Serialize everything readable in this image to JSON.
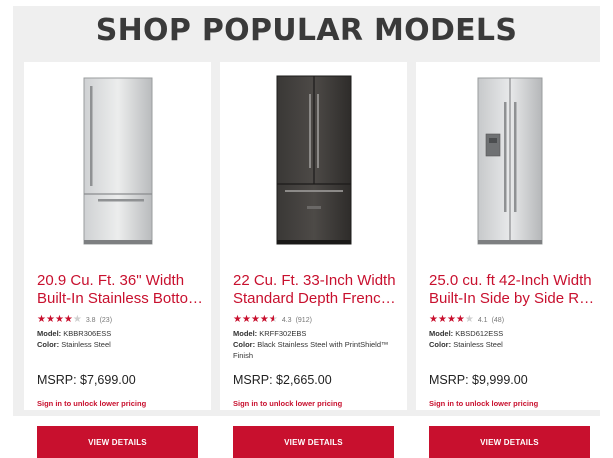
{
  "section": {
    "title": "SHOP POPULAR MODELS"
  },
  "cards": [
    {
      "name_line1": "20.9 Cu. Ft. 36\" Width",
      "name_line2": "Built-In Stainless Botto…",
      "rating_score": "3.8",
      "rating_count": "(23)",
      "stars_filled": 3.8,
      "model_label": "Model:",
      "model": "KBBR306ESS",
      "color_label": "Color:",
      "color": "Stainless Steel",
      "msrp": "MSRP: $7,699.00",
      "signin": "Sign in to unlock lower pricing",
      "button": "VIEW DETAILS",
      "image_icon": "bottom-freezer-refrigerator-stainless"
    },
    {
      "name_line1": "22 Cu. Ft. 33-Inch Width",
      "name_line2": "Standard Depth Frenc…",
      "rating_score": "4.3",
      "rating_count": "(912)",
      "stars_filled": 4.3,
      "model_label": "Model:",
      "model": "KRFF302EBS",
      "color_label": "Color:",
      "color": "Black Stainless Steel with PrintShield™ Finish",
      "msrp": "MSRP: $2,665.00",
      "signin": "Sign in to unlock lower pricing",
      "button": "VIEW DETAILS",
      "image_icon": "french-door-refrigerator-black-stainless"
    },
    {
      "name_line1": "25.0 cu. ft 42-Inch Width",
      "name_line2": "Built-In Side by Side R…",
      "rating_score": "4.1",
      "rating_count": "(48)",
      "stars_filled": 4.1,
      "model_label": "Model:",
      "model": "KBSD612ESS",
      "color_label": "Color:",
      "color": "Stainless Steel",
      "msrp": "MSRP: $9,999.00",
      "signin": "Sign in to unlock lower pricing",
      "button": "VIEW DETAILS",
      "image_icon": "side-by-side-refrigerator-stainless"
    }
  ],
  "colors": {
    "accent": "#c8102e",
    "panel": "#efefef",
    "heading": "#3a3a3a"
  }
}
